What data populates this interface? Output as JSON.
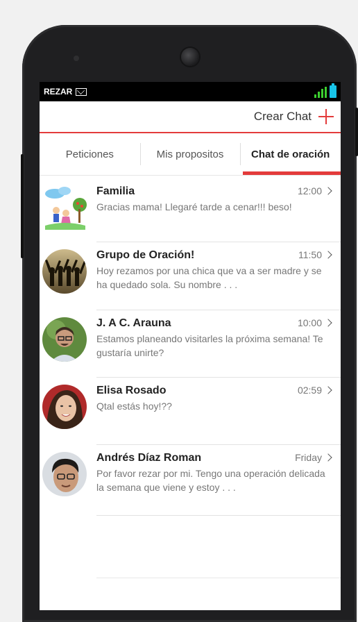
{
  "status_bar": {
    "app_label": "REZAR"
  },
  "action_bar": {
    "create_label": "Crear Chat"
  },
  "tabs": [
    {
      "label": "Peticiones",
      "active": false
    },
    {
      "label": "Mis propositos",
      "active": false
    },
    {
      "label": "Chat de oración",
      "active": true
    }
  ],
  "chats": [
    {
      "name": "Familia",
      "time": "12:00",
      "message": "Gracias mama! Llegaré tarde a cenar!!! beso!"
    },
    {
      "name": "Grupo de Oración!",
      "time": "11:50",
      "message": "Hoy rezamos por una chica que va a ser madre y se ha quedado sola. Su nombre . . ."
    },
    {
      "name": "J. A C. Arauna",
      "time": "10:00",
      "message": "Estamos planeando visitarles la próxima semana! Te gustaría unirte?"
    },
    {
      "name": "Elisa Rosado",
      "time": "02:59",
      "message": "Qtal estás hoy!??"
    },
    {
      "name": "Andrés Díaz Roman",
      "time": "Friday",
      "message": "Por favor rezar por mi. Tengo una operación delicada la semana que viene y estoy . . ."
    }
  ],
  "colors": {
    "accent": "#e33b3b",
    "phone": "#1f1f21",
    "statusbar": "#000000",
    "signal": "#3ccf2f",
    "battery": "#18c3e8"
  },
  "icons": {
    "mail": "mail-icon",
    "signal": "signal-icon",
    "battery": "battery-icon",
    "add": "plus-icon",
    "chevron": "chevron-right-icon"
  }
}
